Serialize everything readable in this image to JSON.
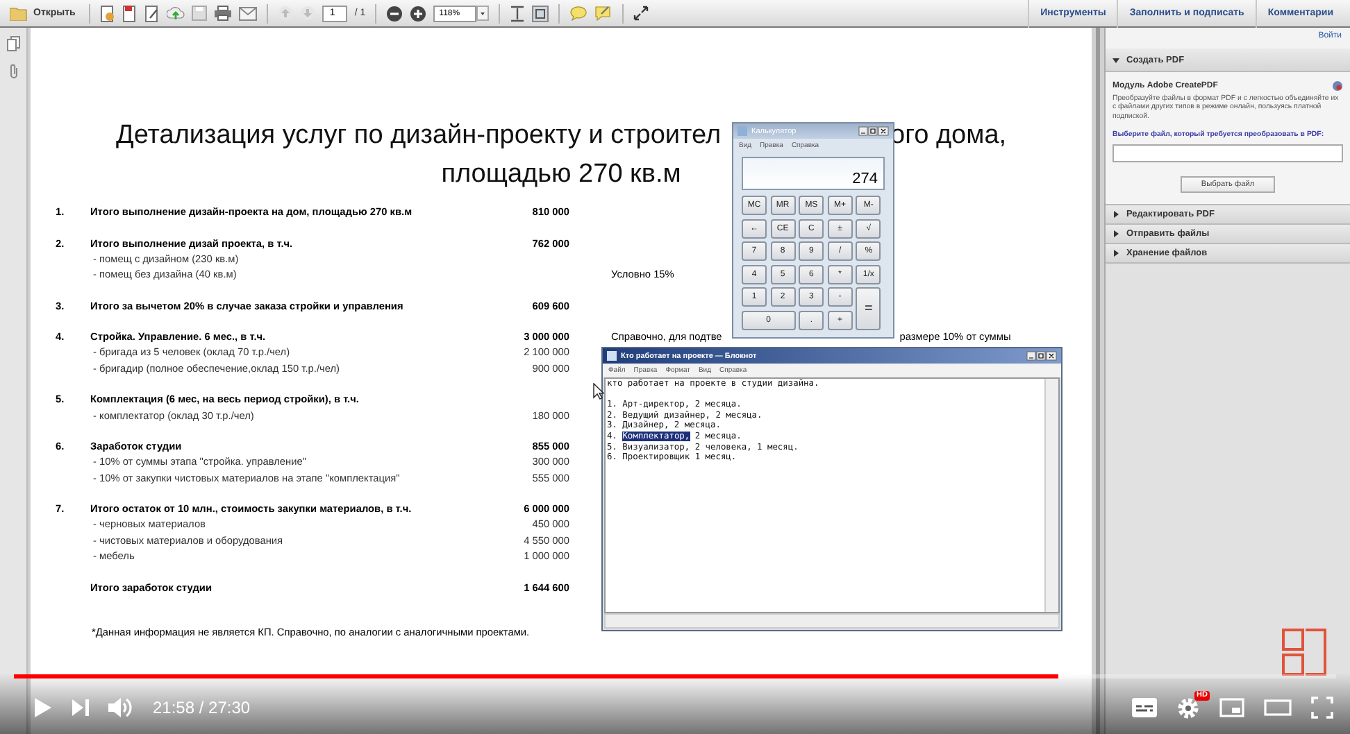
{
  "toolbar": {
    "open": "Открыть",
    "page": "1",
    "page_total": "/ 1",
    "zoom": "118%",
    "tabs": [
      "Инструменты",
      "Заполнить и подписать",
      "Комментарии"
    ]
  },
  "document": {
    "title_lines": [
      [
        "Детализация услуг по дизайн-проекту и строител",
        "ого дома,"
      ],
      [
        "площадью 270 кв.м"
      ]
    ],
    "items": [
      {
        "number": "1.",
        "title": "Итого выполнение дизайн-проекта на дом, площадью 270 кв.м",
        "amount": "810 000"
      },
      {
        "number": "2.",
        "title": "Итого выполнение дизай проекта, в т.ч.",
        "amount": "762 000",
        "sub": [
          {
            "text": "- помещ с дизайном (230 кв.м)"
          },
          {
            "text": "- помещ без дизайна (40 кв.м)",
            "note": [
              "Условно 15%"
            ]
          }
        ]
      },
      {
        "number": "3.",
        "title": "Итого за вычетом 20% в случае заказа стройки и управления",
        "amount": "609 600"
      },
      {
        "number": "4.",
        "title": "Стройка. Управление. 6 мес., в т.ч.",
        "amount": "3 000 000",
        "note": [
          "Справочно, для подтве",
          "размере 10% от суммы"
        ],
        "sub": [
          {
            "text": "- бригада из 5 человек (оклад 70 т.р./чел)",
            "amount": "2 100 000"
          },
          {
            "text": "- бригадир (полное обеспечение,оклад 150 т.р./чел)",
            "amount": "900 000"
          }
        ]
      },
      {
        "number": "5.",
        "title": "Комплектация (6 мес, на весь период стройки), в т.ч.",
        "sub": [
          {
            "text": "- комплектатор (оклад 30 т.р./чел)",
            "amount": "180 000"
          }
        ]
      },
      {
        "number": "6.",
        "title": "Заработок студии",
        "amount": "855 000",
        "sub": [
          {
            "text": "- 10% от суммы этапа \"стройка. управление\"",
            "amount": "300 000"
          },
          {
            "text": "- 10% от закупки чистовых материалов на этапе \"комплектация\"",
            "amount": "555 000"
          }
        ]
      },
      {
        "number": "7.",
        "title": "Итого остаток от 10 млн., стоимость закупки материалов, в т.ч.",
        "amount": "6 000 000",
        "sub": [
          {
            "text": "- черновых материалов",
            "amount": "450 000"
          },
          {
            "text": "- чистовых материалов и оборудования",
            "amount": "4 550 000"
          },
          {
            "text": "- мебель",
            "amount": "1 000 000"
          }
        ]
      }
    ],
    "total": {
      "title": "Итого заработок студии",
      "amount": "1 644 600"
    },
    "footnote": "*Данная информация не является КП. Справочно, по аналогии с аналогичными проектами."
  },
  "right_panel": {
    "sign_in": "Войти",
    "sections": [
      {
        "title": "Создать PDF",
        "expanded": true
      },
      {
        "title": "Редактировать PDF",
        "expanded": false
      },
      {
        "title": "Отправить файлы",
        "expanded": false
      },
      {
        "title": "Хранение файлов",
        "expanded": false
      }
    ],
    "create_pdf": {
      "heading": "Модуль Adobe CreatePDF",
      "description": "Преобразуйте файлы в формат PDF и с легкостью объединяйте их с файлами других типов в режиме онлайн, пользуясь платной подпиской.",
      "prompt": "Выберите файл, который требуется преобразовать в PDF:",
      "button": "Выбрать файл"
    }
  },
  "calculator": {
    "title": "Калькулятор",
    "menu": [
      "Вид",
      "Правка",
      "Справка"
    ],
    "display": "274",
    "keys": [
      {
        "label": "MC",
        "kind": "key"
      },
      {
        "label": "MR",
        "kind": "key"
      },
      {
        "label": "MS",
        "kind": "key"
      },
      {
        "label": "M+",
        "kind": "key"
      },
      {
        "label": "M-",
        "kind": "key"
      },
      {
        "label": "←",
        "kind": "key"
      },
      {
        "label": "CE",
        "kind": "key"
      },
      {
        "label": "C",
        "kind": "key"
      },
      {
        "label": "±",
        "kind": "key"
      },
      {
        "label": "√",
        "kind": "key"
      },
      {
        "label": "7",
        "kind": "key"
      },
      {
        "label": "8",
        "kind": "key"
      },
      {
        "label": "9",
        "kind": "key"
      },
      {
        "label": "/",
        "kind": "key"
      },
      {
        "label": "%",
        "kind": "key"
      },
      {
        "label": "4",
        "kind": "key"
      },
      {
        "label": "5",
        "kind": "key"
      },
      {
        "label": "6",
        "kind": "key"
      },
      {
        "label": "*",
        "kind": "key"
      },
      {
        "label": "1/x",
        "kind": "key"
      },
      {
        "label": "1",
        "kind": "key"
      },
      {
        "label": "2",
        "kind": "key"
      },
      {
        "label": "3",
        "kind": "key"
      },
      {
        "label": "-",
        "kind": "key"
      },
      {
        "label": "=",
        "kind": "tall"
      },
      {
        "label": "0",
        "kind": "wide"
      },
      {
        "label": ".",
        "kind": "key"
      },
      {
        "label": "+",
        "kind": "key"
      }
    ]
  },
  "notepad": {
    "title": "Кто работает на проекте — Блокнот",
    "menu": [
      "Файл",
      "Правка",
      "Формат",
      "Вид",
      "Справка"
    ],
    "paragraphs": [
      [
        [
          {
            "text": "кто работает на проекте в студии дизайна.",
            "selected": false
          }
        ]
      ],
      [
        [
          {
            "text": "1. Арт-директор, 2 месяца.",
            "selected": false
          }
        ],
        [
          {
            "text": "2. Ведущий дизайнер, 2 месяца.",
            "selected": false
          }
        ],
        [
          {
            "text": "3. Дизайнер, 2 месяца.",
            "selected": false
          }
        ],
        [
          {
            "text": "4. ",
            "selected": false
          },
          {
            "text": "Комплектатор,",
            "selected": true
          },
          {
            "text": " 2 месяца.",
            "selected": false
          }
        ],
        [
          {
            "text": "5. Визуализатор, 2 человека, 1 месяц.",
            "selected": false
          }
        ],
        [
          {
            "text": "6. Проектировщик 1 месяц.",
            "selected": false
          }
        ]
      ]
    ]
  },
  "video": {
    "level": 0.79,
    "time": "21:58 / 27:30",
    "hd": "HD"
  }
}
